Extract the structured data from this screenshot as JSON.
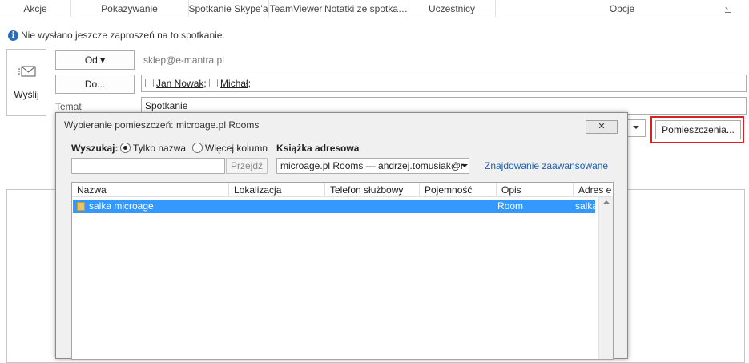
{
  "ribbon": {
    "groups": [
      "Akcje",
      "Pokazywanie",
      "Spotkanie Skype'a",
      "TeamViewer",
      "Notatki ze spotka…",
      "Uczestnicy",
      "Opcje"
    ]
  },
  "info": {
    "text": "Nie wysłano jeszcze zaproszeń na to spotkanie."
  },
  "send": {
    "label": "Wyślij"
  },
  "from": {
    "button": "Od ▾",
    "value": "sklep@e-mantra.pl"
  },
  "to": {
    "button": "Do...",
    "recipients": [
      "Jan Nowak",
      "Michał"
    ]
  },
  "subject": {
    "label": "Temat",
    "value": "Spotkanie"
  },
  "rooms_button": "Pomieszczenia...",
  "dialog": {
    "title": "Wybieranie pomieszczeń: microage.pl Rooms",
    "close": "✕",
    "search_label": "Wyszukaj:",
    "radio_name_only": "Tylko nazwa",
    "radio_more_columns": "Więcej kolumn",
    "address_book_label": "Książka adresowa",
    "search_value": "",
    "go_button": "Przejdź",
    "address_book_value": "microage.pl Rooms — andrzej.tomusiak@r",
    "advanced_find": "Znajdowanie zaawansowane",
    "columns": [
      "Nazwa",
      "Lokalizacja",
      "Telefon służbowy",
      "Pojemność",
      "Opis",
      "Adres e"
    ],
    "rows": [
      {
        "name": "salka microage",
        "location": "",
        "phone": "",
        "capacity": "",
        "description": "Room",
        "email": "salka"
      }
    ]
  },
  "colors": {
    "selection": "#3399ff",
    "link": "#1a5fb4",
    "highlight_border": "#d92121"
  }
}
